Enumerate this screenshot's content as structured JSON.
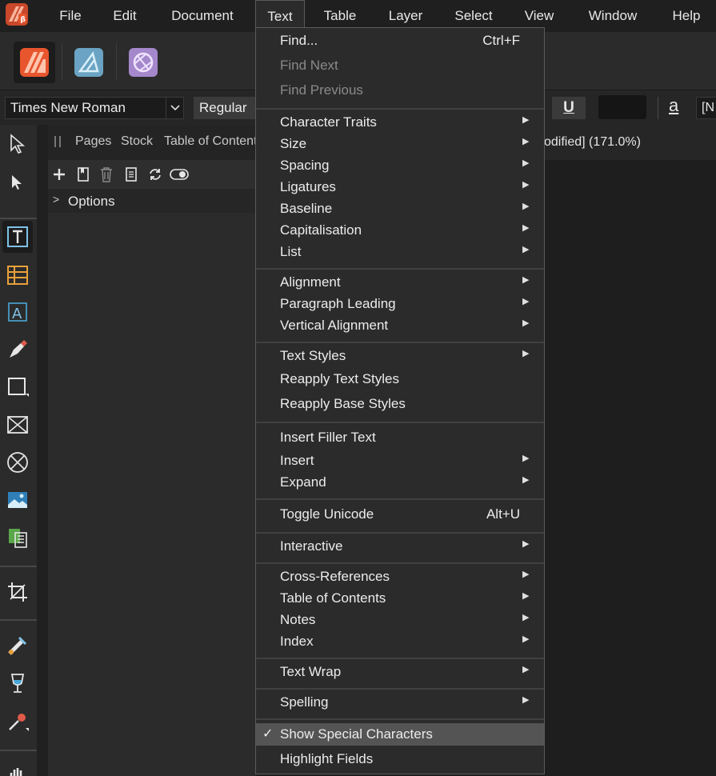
{
  "menubar": {
    "items": [
      {
        "label": "File"
      },
      {
        "label": "Edit"
      },
      {
        "label": "Document"
      },
      {
        "label": "Text"
      },
      {
        "label": "Table"
      },
      {
        "label": "Layer"
      },
      {
        "label": "Select"
      },
      {
        "label": "View"
      },
      {
        "label": "Window"
      },
      {
        "label": "Help"
      }
    ],
    "active": "Text"
  },
  "studio": {
    "personas": [
      {
        "icon": "publisher-persona-icon",
        "color": "#e8562e"
      },
      {
        "icon": "designer-persona-icon",
        "color": "#7fb6d4"
      },
      {
        "icon": "photo-persona-icon",
        "color": "#b79ad8"
      }
    ]
  },
  "context_toolbar": {
    "font_family": "Times New Roman",
    "font_style": "Regular",
    "underline_label": "U",
    "a_label": "a",
    "language_value": "[N"
  },
  "panel": {
    "tabs": [
      "Pages",
      "Stock",
      "Table of Contents"
    ],
    "options_label": "Options"
  },
  "canvas": {
    "doc_tab_text": "odified] (171.0%)"
  },
  "text_menu": {
    "find": {
      "label": "Find...",
      "shortcut": "Ctrl+F"
    },
    "find_next": {
      "label": "Find Next"
    },
    "find_previous": {
      "label": "Find Previous"
    },
    "character_traits": {
      "label": "Character Traits"
    },
    "size": {
      "label": "Size"
    },
    "spacing": {
      "label": "Spacing"
    },
    "ligatures": {
      "label": "Ligatures"
    },
    "baseline": {
      "label": "Baseline"
    },
    "capitalisation": {
      "label": "Capitalisation"
    },
    "list": {
      "label": "List"
    },
    "alignment": {
      "label": "Alignment"
    },
    "paragraph_leading": {
      "label": "Paragraph Leading"
    },
    "vertical_alignment": {
      "label": "Vertical Alignment"
    },
    "text_styles": {
      "label": "Text Styles"
    },
    "reapply_text_styles": {
      "label": "Reapply Text Styles"
    },
    "reapply_base_styles": {
      "label": "Reapply Base Styles"
    },
    "insert_filler_text": {
      "label": "Insert Filler Text"
    },
    "insert": {
      "label": "Insert"
    },
    "expand": {
      "label": "Expand"
    },
    "toggle_unicode": {
      "label": "Toggle Unicode",
      "shortcut": "Alt+U"
    },
    "interactive": {
      "label": "Interactive"
    },
    "cross_references": {
      "label": "Cross-References"
    },
    "table_of_contents": {
      "label": "Table of Contents"
    },
    "notes": {
      "label": "Notes"
    },
    "index": {
      "label": "Index"
    },
    "text_wrap": {
      "label": "Text Wrap"
    },
    "spelling": {
      "label": "Spelling"
    },
    "show_special_characters": {
      "label": "Show Special Characters",
      "checked": true,
      "check_glyph": "✓"
    },
    "highlight_fields": {
      "label": "Highlight Fields"
    },
    "submenu_arrow": "▶"
  }
}
